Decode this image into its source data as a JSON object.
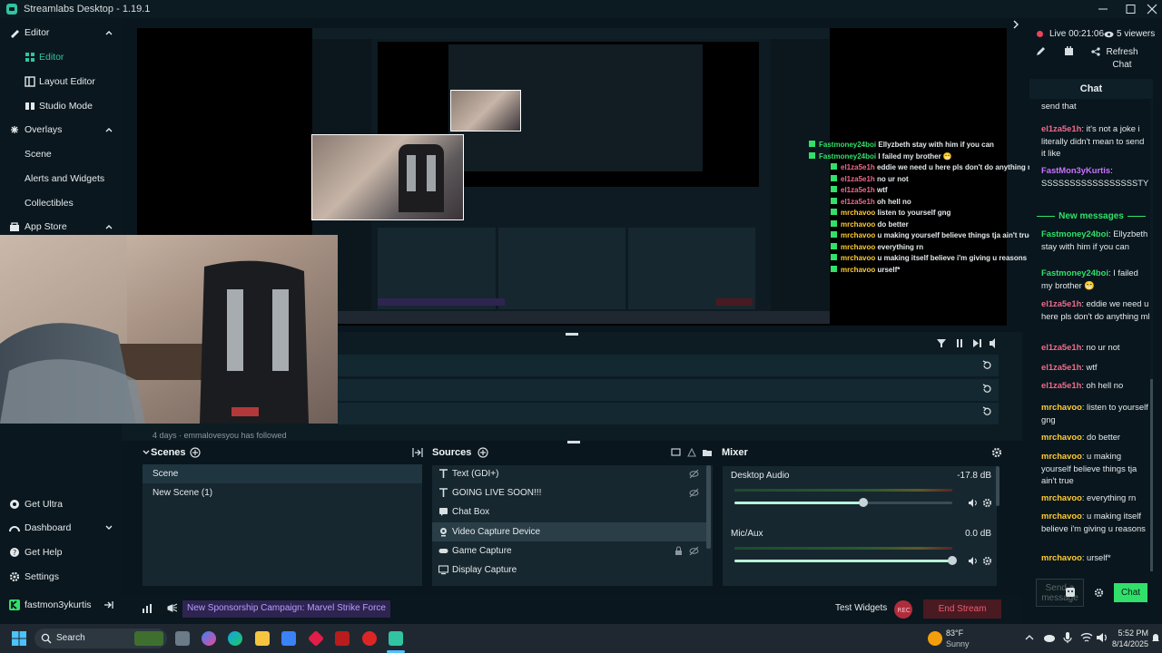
{
  "app": {
    "title": "Streamlabs Desktop - 1.19.1"
  },
  "sidebar": {
    "items": [
      {
        "label": "Editor"
      },
      {
        "label": "Editor"
      },
      {
        "label": "Layout Editor"
      },
      {
        "label": "Studio Mode"
      },
      {
        "label": "Overlays"
      },
      {
        "label": "Scene"
      },
      {
        "label": "Alerts and Widgets"
      },
      {
        "label": "Collectibles"
      },
      {
        "label": "App Store"
      }
    ],
    "bottom": [
      {
        "label": "Get Ultra"
      },
      {
        "label": "Dashboard"
      },
      {
        "label": "Get Help"
      },
      {
        "label": "Settings"
      }
    ],
    "user": "fastmon3ykurtis"
  },
  "events": {
    "partial_text": "4 days  ·  emmalovesyou  has followed"
  },
  "scenes": {
    "title": "Scenes",
    "items": [
      "Scene",
      "New Scene (1)"
    ]
  },
  "sources": {
    "title": "Sources",
    "items": [
      "Text (GDI+)",
      "GOING LIVE SOON!!!",
      "Chat Box",
      "Video Capture Device",
      "Game Capture",
      "Display Capture"
    ]
  },
  "mixer": {
    "title": "Mixer",
    "channels": [
      {
        "name": "Desktop Audio",
        "db": "-17.8 dB",
        "level": 0.59
      },
      {
        "name": "Mic/Aux",
        "db": "0.0 dB",
        "level": 1.0
      }
    ]
  },
  "footer": {
    "sponsor": "New Sponsorship Campaign: Marvel Strike Force",
    "test_widgets": "Test Widgets",
    "end_stream": "End Stream"
  },
  "live": {
    "status": "Live 00:21:06",
    "viewers": "5 viewers",
    "refresh": "Refresh Chat"
  },
  "chat": {
    "title": "Chat",
    "new_messages": "New messages",
    "input_placeholder": "Send a message",
    "send": "Chat",
    "messages": [
      {
        "user": "",
        "text": "send that"
      },
      {
        "user": "el1za5e1h",
        "text": ": it's not a joke i literally didn't mean to send it like"
      },
      {
        "user": "FastMon3yKurtis",
        "text": ": SSSSSSSSSSSSSSSSSTY"
      },
      {
        "user": "Fastmoney24boi",
        "text": ": Ellyzbeth stay with him if you can"
      },
      {
        "user": "Fastmoney24boi",
        "text": ": I failed my brother 😁"
      },
      {
        "user": "el1za5e1h",
        "text": ": eddie we need u here pls don't do anything ml"
      },
      {
        "user": "el1za5e1h",
        "text": ": no ur not"
      },
      {
        "user": "el1za5e1h",
        "text": ": wtf"
      },
      {
        "user": "el1za5e1h",
        "text": ": oh hell no"
      },
      {
        "user": "mrchavoo",
        "text": ": listen to yourself gng"
      },
      {
        "user": "mrchavoo",
        "text": ": do better"
      },
      {
        "user": "mrchavoo",
        "text": ": u making yourself believe things tja ain't true"
      },
      {
        "user": "mrchavoo",
        "text": ": everything rn"
      },
      {
        "user": "mrchavoo",
        "text": ": u making itself believe i'm giving u reasons"
      },
      {
        "user": "mrchavoo",
        "text": ": urself*"
      }
    ]
  },
  "preview_chat": [
    {
      "user": "Fastmoney24boi",
      "text": "Ellyzbeth stay with him if you can"
    },
    {
      "user": "Fastmoney24boi",
      "text": "I failed my brother 😁"
    },
    {
      "user": "el1za5e1h",
      "text": "eddie we need u here pls don't do anything ml"
    },
    {
      "user": "el1za5e1h",
      "text": "no ur not"
    },
    {
      "user": "el1za5e1h",
      "text": "wtf"
    },
    {
      "user": "el1za5e1h",
      "text": "oh hell no"
    },
    {
      "user": "mrchavoo",
      "text": "listen to yourself gng"
    },
    {
      "user": "mrchavoo",
      "text": "do better"
    },
    {
      "user": "mrchavoo",
      "text": "u making yourself believe things tja ain't true"
    },
    {
      "user": "mrchavoo",
      "text": "everything rn"
    },
    {
      "user": "mrchavoo",
      "text": "u making itself believe i'm giving u reasons"
    },
    {
      "user": "mrchavoo",
      "text": "urself*"
    }
  ],
  "taskbar": {
    "search": "Search",
    "weather_temp": "83°F",
    "weather_desc": "Sunny",
    "time": "5:52 PM",
    "date": "8/14/2025"
  },
  "colors": {
    "accent": "#31c3a2",
    "user_green": "#31e06a",
    "user_pink": "#f06b8b",
    "user_yellow": "#ffcc33",
    "user_purple": "#c774ff",
    "live_red": "#e8455a"
  }
}
